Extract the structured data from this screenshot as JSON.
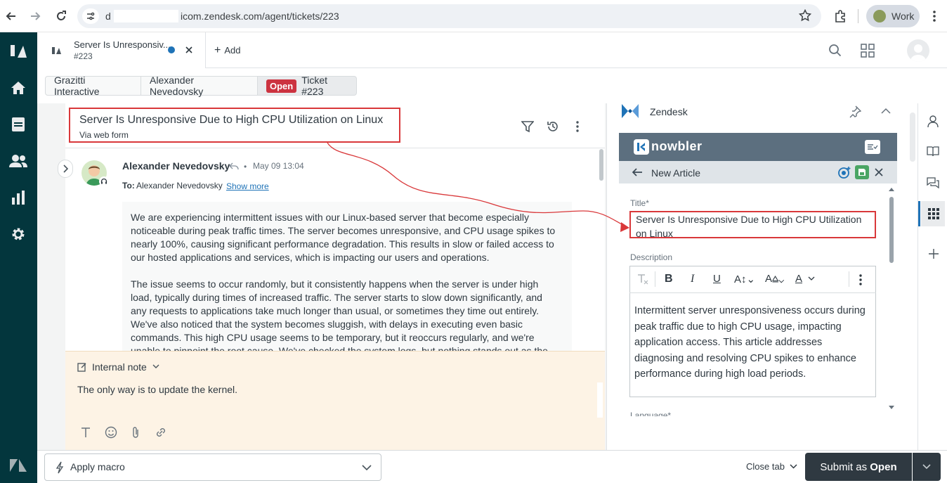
{
  "browser": {
    "url_prefix": "d",
    "url": "icom.zendesk.com/agent/tickets/223",
    "profile_label": "Work"
  },
  "tab": {
    "title": "Server Is Unresponsiv...",
    "number": "#223",
    "add_label": "Add"
  },
  "breadcrumb": {
    "org": "Grazitti Interactive",
    "requester": "Alexander Nevedovsky",
    "status_badge": "Open",
    "ticket": "Ticket #223"
  },
  "ticket": {
    "subject": "Server Is Unresponsive Due to High CPU Utilization on Linux",
    "channel": "Via web form"
  },
  "message": {
    "author": "Alexander Nevedovsky",
    "separator": "•",
    "timestamp": "May 09 13:04",
    "to_label": "To:",
    "to_name": "Alexander Nevedovsky",
    "show_more": "Show more",
    "paragraph1": "We are experiencing intermittent issues with our Linux-based server that become especially noticeable during peak traffic times. The server becomes unresponsive, and CPU usage spikes to nearly 100%, causing significant performance degradation. This results in slow or failed access to our hosted applications and services, which is impacting our users and operations.",
    "paragraph2": "The issue seems to occur randomly, but it consistently happens when the server is under high load, typically during times of increased traffic. The server starts to slow down significantly, and any requests to applications take much longer than usual, or sometimes they time out entirely. We've also noticed that the system becomes sluggish, with delays in executing even basic commands. This high CPU usage seems to be temporary, but it reoccurs regularly, and we're unable to pinpoint the root cause. We've checked the system logs, but nothing stands out as the primary issue. We"
  },
  "note": {
    "mode_label": "Internal note",
    "text": "The only way is to update the kernel."
  },
  "app": {
    "name": "Zendesk",
    "brand": "nowbler",
    "view_title": "New Article",
    "title_label": "Title*",
    "title_value": "Server Is Unresponsive Due to High CPU Utilization on Linux",
    "description_label": "Description",
    "description_text": "Intermittent server unresponsiveness occurs during peak traffic due to high CPU usage, impacting application access. This article addresses diagnosing and resolving CPU spikes to enhance performance during high load periods.",
    "next_label": "Language*"
  },
  "bottom": {
    "macro_label": "Apply macro",
    "close_tab": "Close tab",
    "submit_prefix": "Submit as ",
    "submit_status": "Open"
  },
  "colors": {
    "nav_bg": "#03363d",
    "highlight_red": "#d9383a",
    "status_open": "#cc3340",
    "app_header": "#5c6f7f",
    "note_bg": "#fdf3e5",
    "submit_bg": "#2f3941"
  }
}
